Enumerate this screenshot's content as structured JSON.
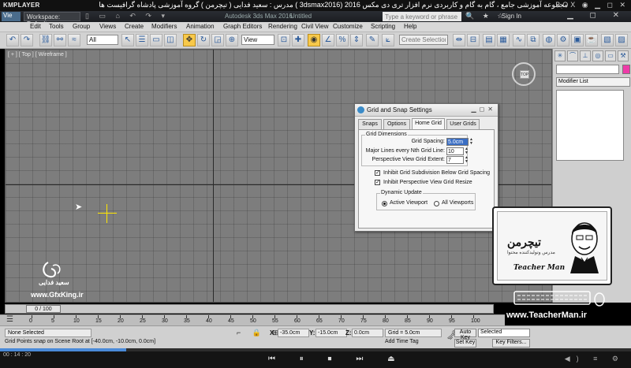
{
  "kmplayer": {
    "logo": "KMPLAYER",
    "title": "مجموعه آموزشی جامع ، گام به گام و کاربردی نرم افزار تری دی مکس 2016 (3dsmax2016 )   مدرس : سعید فدایی ( تیچرمن ) گروه آموزشی پادشاه گرافیست ها",
    "window_buttons": "BOX ◉ ▁ ◻ ✕",
    "time": "00 : 14 : 20",
    "controls": "⏮ ⏸ ⏹ ⏭ ⏏",
    "right_controls": "◀) ≡ ⚙"
  },
  "app": {
    "icon_label": "Vie",
    "workspace": "Workspace: Default",
    "quick_tools": "▯ ▭ ⌂ ↶ ↷ ▾",
    "app_name": "Autodesk 3ds Max 2016",
    "doc_name": "Untitled",
    "search_placeholder": "Type a keyword or phrase",
    "search_tools": "🔍 ★ ☆",
    "sign_in": "Sign In",
    "window_buttons": "▁ ◻ ✕"
  },
  "menu": {
    "items": [
      "Edit",
      "Tools",
      "Group",
      "Views",
      "Create",
      "Modifiers",
      "Animation",
      "Graph Editors",
      "Rendering",
      "Civil View",
      "Customize",
      "Scripting",
      "Help"
    ]
  },
  "toolbar": {
    "filter": "All",
    "ref_coord": "View",
    "selection_set_placeholder": "Create Selection Se"
  },
  "viewport": {
    "label": "[ + ] [ Top ] [ Wireframe ]",
    "viewcube_face": "TOP",
    "watermark_name": "سعید فدایی",
    "watermark_site": "www.GfxKing.ir"
  },
  "dialog": {
    "title": "Grid and Snap Settings",
    "tabs": [
      "Snaps",
      "Options",
      "Home Grid",
      "User Grids"
    ],
    "active_tab": "Home Grid",
    "grid_dimensions": {
      "title": "Grid Dimensions",
      "grid_spacing_label": "Grid Spacing:",
      "grid_spacing": "5.0cm",
      "major_lines_label": "Major Lines every Nth Grid Line:",
      "major_lines": "10",
      "perspective_extent_label": "Perspective View Grid Extent:",
      "perspective_extent": "7"
    },
    "inhibit_subdivision": "Inhibit Grid Subdivision Below Grid Spacing",
    "inhibit_perspective": "Inhibit Perspective View Grid Resize",
    "dynamic_update": {
      "title": "Dynamic Update",
      "active_viewport": "Active Viewport",
      "all_viewports": "All Viewports",
      "selected": "Active Viewport"
    }
  },
  "command_panel": {
    "modifier_list": "Modifier List",
    "object_color": "#ee3aa8"
  },
  "teacherman": {
    "logo": "تیچرمن",
    "sub": "مدرس وتولیدکننده محتوا",
    "name": "Teacher Man",
    "url": "www.TeacherMan.ir"
  },
  "timeline": {
    "frame": "0 / 100",
    "ticks": [
      "0",
      "5",
      "10",
      "15",
      "20",
      "25",
      "30",
      "35",
      "40",
      "45",
      "50",
      "55",
      "60",
      "65",
      "70",
      "75",
      "80",
      "85",
      "90",
      "95",
      "100"
    ]
  },
  "status": {
    "selection": "None Selected",
    "prompt": "Grid Points snap on Scene Root at [-40.0cm, -10.0cm, 0.0cm]",
    "icons": "⌐ 🔒 ⊞",
    "x_label": "X:",
    "x": "-35.0cm",
    "y_label": "Y:",
    "y": "-15.0cm",
    "z_label": "Z:",
    "z": "0.0cm",
    "grid": "Grid = 5.0cm",
    "add_time_tag": "Add Time Tag",
    "auto_key": "Auto Key",
    "set_key": "Set Key",
    "selected": "Selected",
    "key_filters": "Key Filters..."
  }
}
